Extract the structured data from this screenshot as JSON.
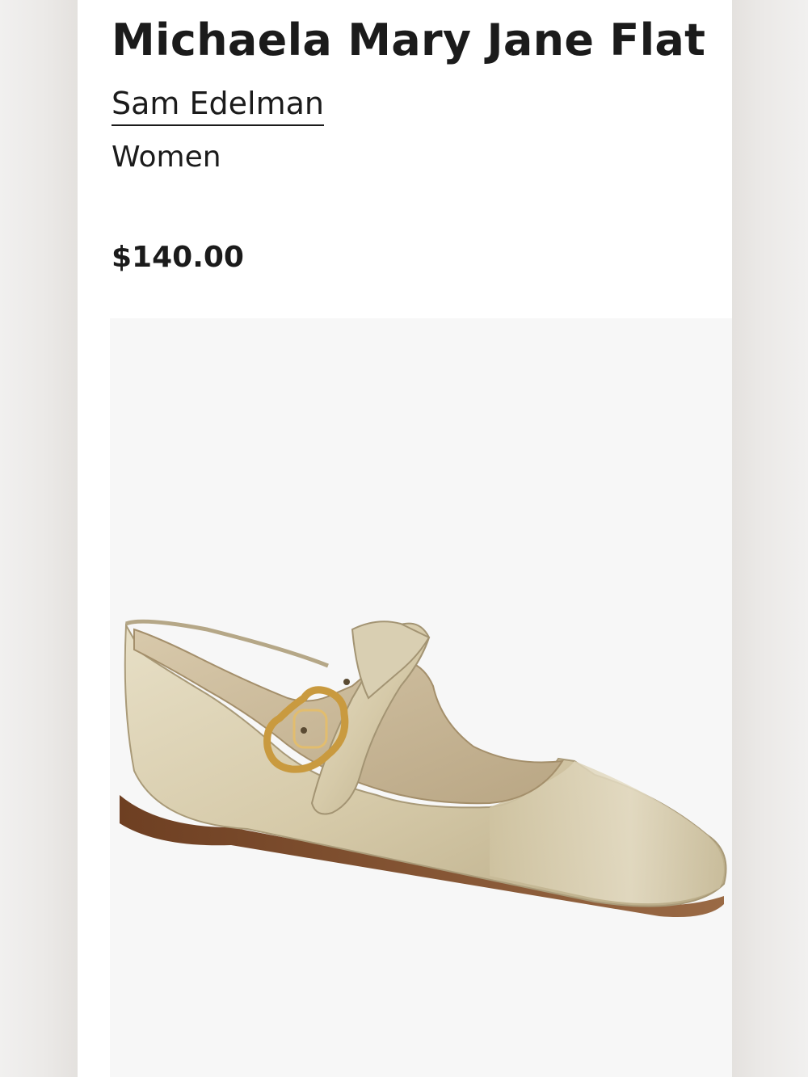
{
  "product": {
    "title": "Michaela Mary Jane Flat",
    "brand": "Sam Edelman",
    "category": "Women",
    "price": "$140.00"
  },
  "image": {
    "subject": "shoe-image",
    "colors": {
      "leather": "#d9cfb2",
      "lining": "#c9b99a",
      "buckle": "#c99a3f",
      "sole": "#7a4a2a"
    }
  }
}
